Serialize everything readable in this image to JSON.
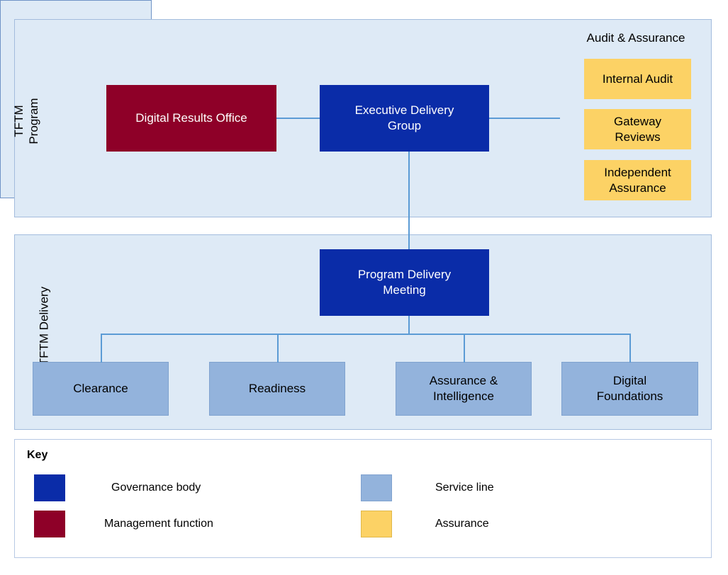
{
  "diagram": {
    "bands": [
      {
        "id": "program",
        "label": "TFTM\nProgram"
      },
      {
        "id": "delivery",
        "label": "TFTM Delivery"
      }
    ],
    "nodes": {
      "digital_results_office": "Digital Results Office",
      "executive_delivery_group": "Executive Delivery\nGroup",
      "program_delivery_meeting": "Program Delivery\nMeeting",
      "clearance": "Clearance",
      "readiness": "Readiness",
      "assurance_intelligence": "Assurance &\nIntelligence",
      "digital_foundations": "Digital\nFoundations"
    },
    "audit_panel": {
      "title": "Audit & Assurance",
      "items": [
        "Internal Audit",
        "Gateway\nReviews",
        "Independent\nAssurance"
      ]
    },
    "key": {
      "title": "Key",
      "items": [
        {
          "label": "Governance body",
          "color": "#0A2CA8"
        },
        {
          "label": "Management function",
          "color": "#8E0028"
        },
        {
          "label": "Service line",
          "color": "#93B3DC"
        },
        {
          "label": "Assurance",
          "color": "#FCD265"
        }
      ]
    },
    "colors": {
      "panel_background": "#DEEAF6",
      "panel_border": "#A3BCDD",
      "connector": "#5B9BD5",
      "governance": "#0A2CA8",
      "management": "#8E0028",
      "service_line": "#93B3DC",
      "assurance": "#FCD265",
      "key_background": "#FFFFFF"
    }
  }
}
